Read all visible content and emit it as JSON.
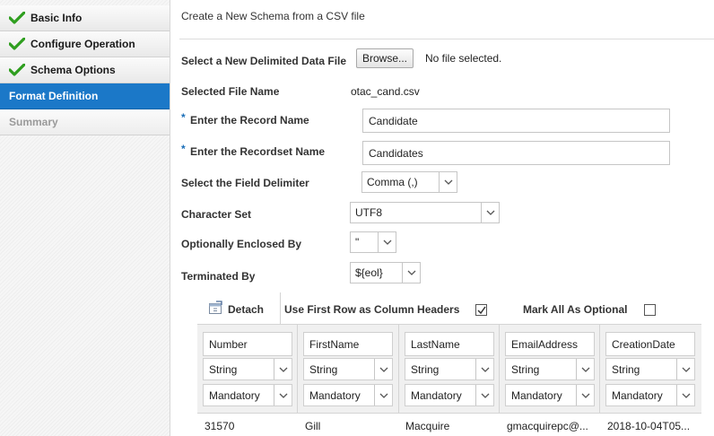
{
  "sidebar": {
    "steps": [
      {
        "label": "Basic Info",
        "state": "done"
      },
      {
        "label": "Configure Operation",
        "state": "done"
      },
      {
        "label": "Schema Options",
        "state": "done"
      },
      {
        "label": "Format Definition",
        "state": "active"
      },
      {
        "label": "Summary",
        "state": "disabled"
      }
    ]
  },
  "main": {
    "title": "Create a New Schema from a CSV file",
    "file": {
      "label": "Select a New Delimited Data File",
      "browse_label": "Browse...",
      "status": "No file selected."
    },
    "selected_file": {
      "label": "Selected File Name",
      "value": "otac_cand.csv"
    },
    "record_name": {
      "label": "Enter the Record Name",
      "value": "Candidate",
      "required_mark": "*"
    },
    "recordset_name": {
      "label": "Enter the Recordset Name",
      "value": "Candidates",
      "required_mark": "*"
    },
    "field_delimiter": {
      "label": "Select the Field Delimiter",
      "value": "Comma (,)"
    },
    "character_set": {
      "label": "Character Set",
      "value": "UTF8"
    },
    "enclosed_by": {
      "label": "Optionally Enclosed By",
      "value": "\""
    },
    "terminated_by": {
      "label": "Terminated By",
      "value": "${eol}"
    }
  },
  "table": {
    "detach_label": "Detach",
    "first_row_label": "Use First Row as Column Headers",
    "first_row_checked": true,
    "mark_optional_label": "Mark All As Optional",
    "mark_optional_checked": false,
    "columns": [
      {
        "header": "Number",
        "type": "String",
        "mode": "Mandatory",
        "sample": "31570"
      },
      {
        "header": "FirstName",
        "type": "String",
        "mode": "Mandatory",
        "sample": "Gill"
      },
      {
        "header": "LastName",
        "type": "String",
        "mode": "Mandatory",
        "sample": "Macquire"
      },
      {
        "header": "EmailAddress",
        "type": "String",
        "mode": "Mandatory",
        "sample": "gmacquirepc@..."
      },
      {
        "header": "CreationDate",
        "type": "String",
        "mode": "Mandatory",
        "sample": "2018-10-04T05..."
      }
    ]
  },
  "colors": {
    "accent": "#1b78c8",
    "check_green": "#2e9e1e",
    "required_blue": "#1b6fb8"
  }
}
